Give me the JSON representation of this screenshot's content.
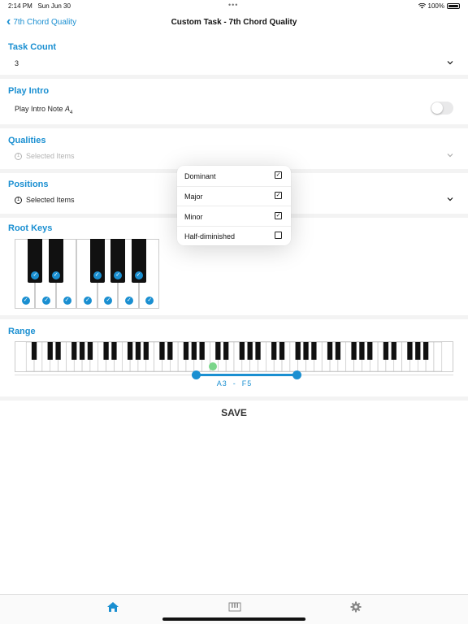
{
  "status": {
    "time": "2:14 PM",
    "date": "Sun Jun 30",
    "battery": "100%"
  },
  "nav": {
    "back_label": "7th Chord Quality",
    "title": "Custom Task - 7th Chord Quality"
  },
  "task_count": {
    "title": "Task Count",
    "value": "3"
  },
  "play_intro": {
    "title": "Play Intro",
    "label_main": "Play Intro Note ",
    "note": "A",
    "octave": "4",
    "enabled": false
  },
  "qualities": {
    "title": "Qualities",
    "selected_label": "Selected Items"
  },
  "positions": {
    "title": "Positions",
    "selected_label": "Selected Items"
  },
  "root_keys": {
    "title": "Root Keys",
    "white_checked": [
      true,
      true,
      true,
      true,
      true,
      true,
      true
    ],
    "black_checked": [
      true,
      true,
      true,
      true,
      true
    ]
  },
  "range": {
    "title": "Range",
    "low": "A3",
    "separator": "-",
    "high": "F5"
  },
  "save_label": "SAVE",
  "popover": {
    "items": [
      {
        "label": "Dominant",
        "checked": true
      },
      {
        "label": "Major",
        "checked": true
      },
      {
        "label": "Minor",
        "checked": true
      },
      {
        "label": "Half-diminished",
        "checked": false
      }
    ]
  },
  "colors": {
    "accent": "#1a8fd1",
    "green": "#7ad58a"
  },
  "tabs": [
    {
      "icon": "home-icon",
      "active": true
    },
    {
      "icon": "piano-icon",
      "active": false
    },
    {
      "icon": "gear-icon",
      "active": false
    }
  ]
}
